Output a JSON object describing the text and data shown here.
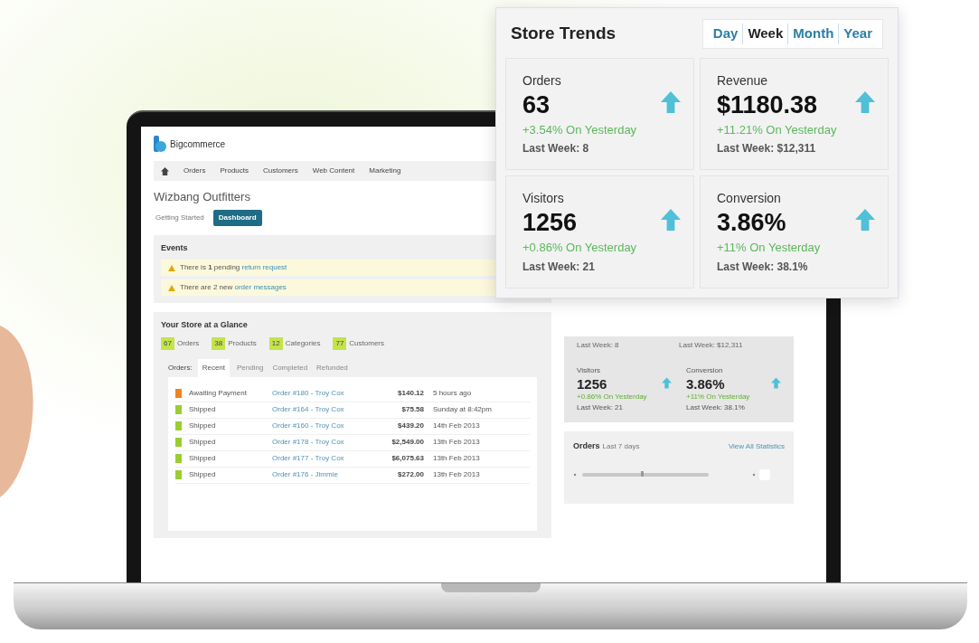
{
  "app": {
    "logo": "Bigcommerce",
    "nav": [
      "Orders",
      "Products",
      "Customers",
      "Web Content",
      "Marketing"
    ],
    "store_name": "Wizbang Outfitters",
    "tabs": [
      {
        "label": "Getting Started",
        "selected": false
      },
      {
        "label": "Dashboard",
        "selected": true
      }
    ],
    "events": {
      "title": "Events",
      "items": [
        {
          "text": "There is **1** pending",
          "link": "return request"
        },
        {
          "text": "There are 2 new",
          "link": "order messages"
        }
      ]
    },
    "glance": {
      "title": "Your Store at a Glance",
      "counts": [
        {
          "count": "67",
          "label": "Orders"
        },
        {
          "count": "38",
          "label": "Products"
        },
        {
          "count": "12",
          "label": "Categories"
        },
        {
          "count": "77",
          "label": "Customers"
        }
      ],
      "order_tabs_label": "Orders:",
      "order_tabs": [
        {
          "label": "Recent",
          "selected": true
        },
        {
          "label": "Pending",
          "selected": false
        },
        {
          "label": "Completed",
          "selected": false
        },
        {
          "label": "Refunded",
          "selected": false
        }
      ],
      "rows": [
        {
          "color": "#f0821e",
          "status": "Awaiting Payment",
          "order": "Order #180 - Troy Cox",
          "amount": "$140.12",
          "time": "5 hours ago"
        },
        {
          "color": "#9acd32",
          "status": "Shipped",
          "order": "Order #164 - Troy Cox",
          "amount": "$75.58",
          "time": "Sunday at 8:42pm"
        },
        {
          "color": "#9acd32",
          "status": "Shipped",
          "order": "Order #160 - Troy Cox",
          "amount": "$439.20",
          "time": "14th Feb 2013"
        },
        {
          "color": "#9acd32",
          "status": "Shipped",
          "order": "Order #178 - Troy Cox",
          "amount": "$2,549.00",
          "time": "13th Feb 2013"
        },
        {
          "color": "#9acd32",
          "status": "Shipped",
          "order": "Order #177 - Troy Cox",
          "amount": "$6,075.63",
          "time": "13th Feb 2013"
        },
        {
          "color": "#9acd32",
          "status": "Shipped",
          "order": "Order #176 - Jimmie",
          "amount": "$272.00",
          "time": "13th Feb 2013"
        }
      ]
    },
    "side_stats": {
      "last_week_top": [
        "Last Week: 8",
        "Last Week: $12,311"
      ],
      "metrics": [
        {
          "label": "Visitors",
          "value": "1256",
          "change": "+0.86% On Yesterday",
          "last_week": "Last Week: 21"
        },
        {
          "label": "Conversion",
          "value": "3.86%",
          "change": "+11% On Yesterday",
          "last_week": "Last Week: 38.1%"
        }
      ]
    },
    "orders_chart": {
      "title": "Orders",
      "subtitle": "Last 7 days",
      "link": "View All Statistics"
    }
  },
  "store_trends": {
    "title": "Store Trends",
    "periods": [
      {
        "label": "Day",
        "selected": false
      },
      {
        "label": "Week",
        "selected": true
      },
      {
        "label": "Month",
        "selected": false
      },
      {
        "label": "Year",
        "selected": false
      }
    ],
    "metrics": [
      {
        "label": "Orders",
        "value": "63",
        "change": "+3.54% On Yesterday",
        "last_week": "Last Week: 8"
      },
      {
        "label": "Revenue",
        "value": "$1180.38",
        "change": "+11.21% On Yesterday",
        "last_week": "Last Week: $12,311"
      },
      {
        "label": "Visitors",
        "value": "1256",
        "change": "+0.86% On Yesterday",
        "last_week": "Last Week: 21"
      },
      {
        "label": "Conversion",
        "value": "3.86%",
        "change": "+11% On Yesterday",
        "last_week": "Last Week: 38.1%"
      }
    ]
  }
}
